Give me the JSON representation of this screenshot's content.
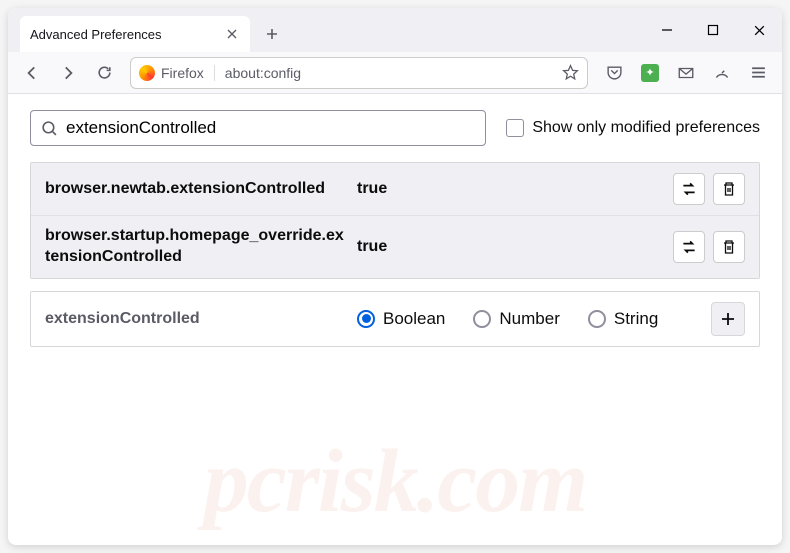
{
  "tab": {
    "title": "Advanced Preferences"
  },
  "urlbar": {
    "identity": "Firefox",
    "url": "about:config"
  },
  "search": {
    "value": "extensionControlled"
  },
  "checkbox": {
    "label": "Show only modified preferences"
  },
  "prefs": [
    {
      "name": "browser.newtab.extensionControlled",
      "value": "true"
    },
    {
      "name": "browser.startup.homepage_override.extensionControlled",
      "value": "true"
    }
  ],
  "newPref": {
    "name": "extensionControlled",
    "types": [
      "Boolean",
      "Number",
      "String"
    ],
    "selected": "Boolean"
  },
  "watermark": "pcrisk.com"
}
